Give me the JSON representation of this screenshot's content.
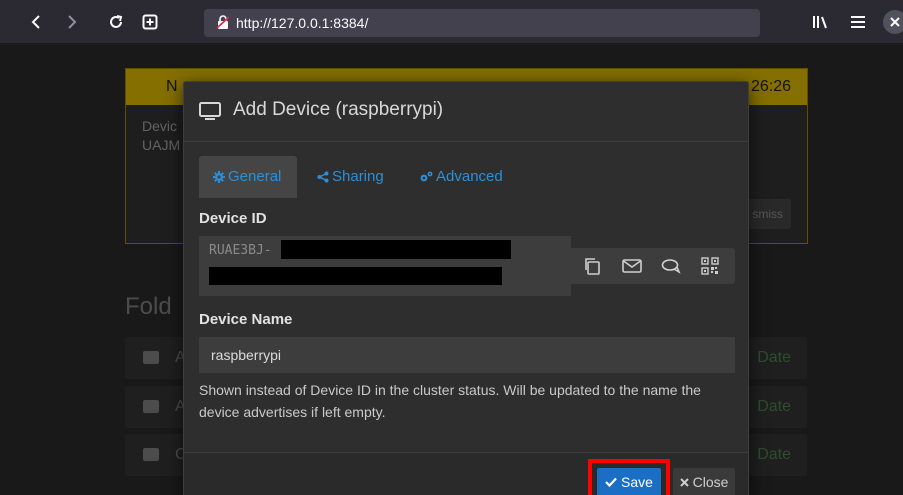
{
  "browser": {
    "url": "http://127.0.0.1:8384/"
  },
  "background": {
    "notice_head_left": "N",
    "notice_time": "26:26",
    "notice_line1": "Devic",
    "notice_line2": "UAJM",
    "dismiss_label": "smiss",
    "folders_title": "Fold",
    "folder_rows": [
      {
        "name": "A",
        "status": "Date"
      },
      {
        "name": "A",
        "status": "Date"
      },
      {
        "name": "C",
        "status": "Date"
      }
    ]
  },
  "modal": {
    "title": "Add Device (raspberrypi)",
    "tabs": [
      {
        "label": "General",
        "icon": "gear-icon",
        "active": true
      },
      {
        "label": "Sharing",
        "icon": "share-icon",
        "active": false
      },
      {
        "label": "Advanced",
        "icon": "cogs-icon",
        "active": false
      }
    ],
    "device_id_label": "Device ID",
    "device_id_prefix": "RUAE3BJ-",
    "device_name_label": "Device Name",
    "device_name_value": "raspberrypi",
    "help_text": "Shown instead of Device ID in the cluster status. Will be updated to the name the device advertises if left empty.",
    "save_label": "Save",
    "close_label": "Close"
  },
  "colors": {
    "accent": "#2c8fd8",
    "save_button": "#1a6fc4",
    "highlight": "#ff0000",
    "notice": "#b89a00"
  }
}
